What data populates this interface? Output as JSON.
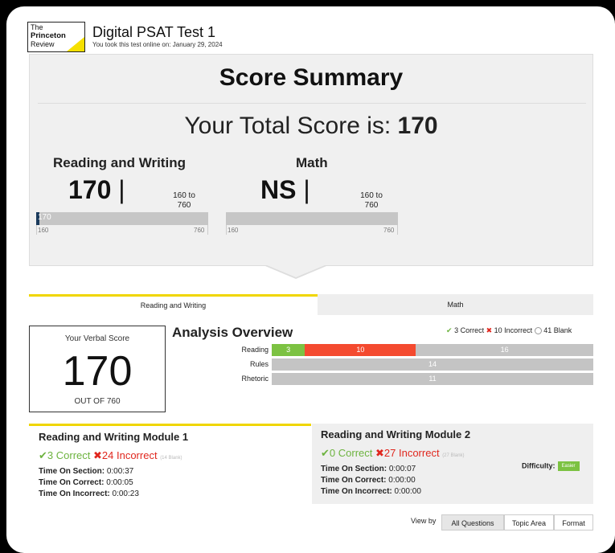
{
  "header": {
    "logo_lines": [
      "The",
      "Princeton",
      "Review"
    ],
    "title": "Digital PSAT Test 1",
    "subtitle": "You took this test online on: January 29, 2024"
  },
  "summary": {
    "heading": "Score Summary",
    "total_prefix": "Your Total Score is: ",
    "total_value": "170",
    "sections": [
      {
        "label": "Reading and Writing",
        "score": "170",
        "range": "160 to 760",
        "gauge_value": 170,
        "gauge_label": "170",
        "axis_min": "160",
        "axis_max": "760"
      },
      {
        "label": "Math",
        "score": "NS",
        "range": "160 to 760",
        "gauge_value": null,
        "gauge_label": "",
        "axis_min": "160",
        "axis_max": "760"
      }
    ]
  },
  "tabs": [
    {
      "label": "Reading and Writing",
      "active": true
    },
    {
      "label": "Math",
      "active": false
    }
  ],
  "verbal": {
    "label": "Your Verbal Score",
    "score": "170",
    "out_of": "OUT OF 760"
  },
  "analysis": {
    "title": "Analysis Overview",
    "legend": {
      "correct": "3 Correct",
      "incorrect": "10 Incorrect",
      "blank": "41 Blank"
    },
    "rows": [
      {
        "label": "Reading",
        "correct": 3,
        "incorrect": 10,
        "blank": 16,
        "correct_text": "3",
        "incorrect_text": "10",
        "blank_text": "16"
      },
      {
        "label": "Rules",
        "correct": 0,
        "incorrect": 0,
        "blank": 14,
        "correct_text": "",
        "incorrect_text": "",
        "blank_text": "14"
      },
      {
        "label": "Rhetoric",
        "correct": 0,
        "incorrect": 0,
        "blank": 11,
        "correct_text": "",
        "incorrect_text": "",
        "blank_text": "11"
      }
    ]
  },
  "modules": [
    {
      "title": "Reading and Writing Module 1",
      "correct": "3 Correct",
      "incorrect": "24 Incorrect",
      "blank": "(14 Blank)",
      "time_section_label": "Time On Section:",
      "time_section": "0:00:37",
      "time_correct_label": "Time On Correct:",
      "time_correct": "0:00:05",
      "time_incorrect_label": "Time On Incorrect:",
      "time_incorrect": "0:00:23"
    },
    {
      "title": "Reading and Writing Module 2",
      "correct": "0 Correct",
      "incorrect": "27 Incorrect",
      "blank": "(27 Blank)",
      "time_section_label": "Time On Section:",
      "time_section": "0:00:07",
      "time_correct_label": "Time On Correct:",
      "time_correct": "0:00:00",
      "time_incorrect_label": "Time On Incorrect:",
      "time_incorrect": "0:00:00",
      "difficulty_label": "Difficulty:",
      "difficulty": "Easier"
    }
  ],
  "view_by": {
    "label": "View by",
    "options": [
      "All Questions",
      "Topic Area",
      "Format"
    ],
    "selected": "All Questions"
  },
  "colors": {
    "accent_yellow": "#f0d600",
    "correct_green": "#7cc242",
    "incorrect_red": "#f44a2f",
    "blank_gray": "#c4c4c4",
    "gauge_navy": "#1a3a5c"
  },
  "icons": {
    "correct": "check-icon",
    "incorrect": "cross-icon",
    "blank": "circle-icon"
  }
}
